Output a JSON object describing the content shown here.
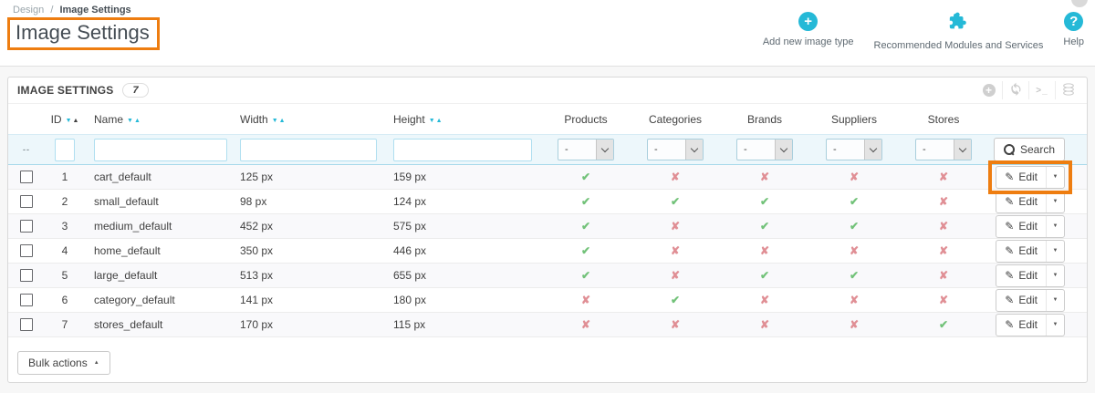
{
  "breadcrumb": {
    "section": "Design",
    "separator": "/",
    "current": "Image Settings"
  },
  "page_title": "Image Settings",
  "header_actions": {
    "add_new": "Add new image type",
    "modules": "Recommended Modules and Services",
    "help": "Help"
  },
  "panel": {
    "title": "IMAGE SETTINGS",
    "count": "7"
  },
  "table": {
    "headers": {
      "id": "ID",
      "name": "Name",
      "width": "Width",
      "height": "Height",
      "products": "Products",
      "categories": "Categories",
      "brands": "Brands",
      "suppliers": "Suppliers",
      "stores": "Stores"
    },
    "filters": {
      "checkbox_placeholder": "--",
      "select_value": "-",
      "search_label": "Search"
    },
    "edit_label": "Edit",
    "rows": [
      {
        "id": "1",
        "name": "cart_default",
        "width": "125 px",
        "height": "159 px",
        "marks": [
          true,
          false,
          false,
          false,
          false
        ],
        "annotated": true
      },
      {
        "id": "2",
        "name": "small_default",
        "width": "98 px",
        "height": "124 px",
        "marks": [
          true,
          true,
          true,
          true,
          false
        ],
        "annotated": false
      },
      {
        "id": "3",
        "name": "medium_default",
        "width": "452 px",
        "height": "575 px",
        "marks": [
          true,
          false,
          true,
          true,
          false
        ],
        "annotated": false
      },
      {
        "id": "4",
        "name": "home_default",
        "width": "350 px",
        "height": "446 px",
        "marks": [
          true,
          false,
          false,
          false,
          false
        ],
        "annotated": false
      },
      {
        "id": "5",
        "name": "large_default",
        "width": "513 px",
        "height": "655 px",
        "marks": [
          true,
          false,
          true,
          true,
          false
        ],
        "annotated": false
      },
      {
        "id": "6",
        "name": "category_default",
        "width": "141 px",
        "height": "180 px",
        "marks": [
          false,
          true,
          false,
          false,
          false
        ],
        "annotated": false
      },
      {
        "id": "7",
        "name": "stores_default",
        "width": "170 px",
        "height": "115 px",
        "marks": [
          false,
          false,
          false,
          false,
          true
        ],
        "annotated": false
      }
    ]
  },
  "bulk_actions": {
    "label": "Bulk actions"
  },
  "icons": {
    "check": "✔",
    "cross": "✘",
    "pencil": "✎",
    "terminal": ">_",
    "plus": "+",
    "question": "?"
  },
  "colors": {
    "accent_blue": "#25b9d7",
    "annotation_orange": "#ee7d10",
    "check_green": "#72c279",
    "cross_red": "#e08f95"
  }
}
